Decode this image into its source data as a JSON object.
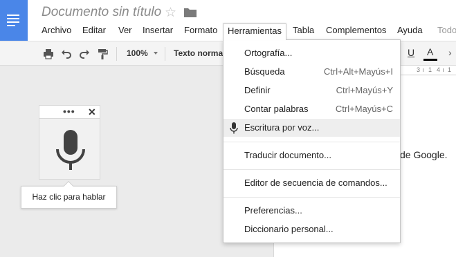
{
  "document": {
    "title": "Documento sin título"
  },
  "menubar": {
    "items": [
      "Archivo",
      "Editar",
      "Ver",
      "Insertar",
      "Formato",
      "Herramientas",
      "Tabla",
      "Complementos",
      "Ayuda",
      "Todo"
    ]
  },
  "toolbar": {
    "zoom": "100%",
    "style": "Texto normal",
    "underline_label": "U",
    "text_color_label": "A",
    "text_color": "#000000"
  },
  "ruler": {
    "marks": [
      "3",
      "1",
      "4",
      "1",
      "5",
      "1"
    ]
  },
  "document_body": {
    "visible_text": "de Google."
  },
  "voice_widget": {
    "menu_label": "•••",
    "close_label": "✕",
    "tooltip": "Haz clic para hablar"
  },
  "tools_menu": {
    "items": [
      {
        "label": "Ortografía...",
        "shortcut": ""
      },
      {
        "label": "Búsqueda",
        "shortcut": "Ctrl+Alt+Mayús+I"
      },
      {
        "label": "Definir",
        "shortcut": "Ctrl+Mayús+Y"
      },
      {
        "label": "Contar palabras",
        "shortcut": "Ctrl+Mayús+C"
      },
      {
        "label": "Escritura por voz...",
        "shortcut": ""
      },
      {
        "label": "Traducir documento...",
        "shortcut": ""
      },
      {
        "label": "Editor de secuencia de comandos...",
        "shortcut": ""
      },
      {
        "label": "Preferencias...",
        "shortcut": ""
      },
      {
        "label": "Diccionario personal...",
        "shortcut": ""
      }
    ]
  },
  "colors": {
    "brand_blue": "#4a86e8",
    "hover_grey": "#eeeeee"
  }
}
